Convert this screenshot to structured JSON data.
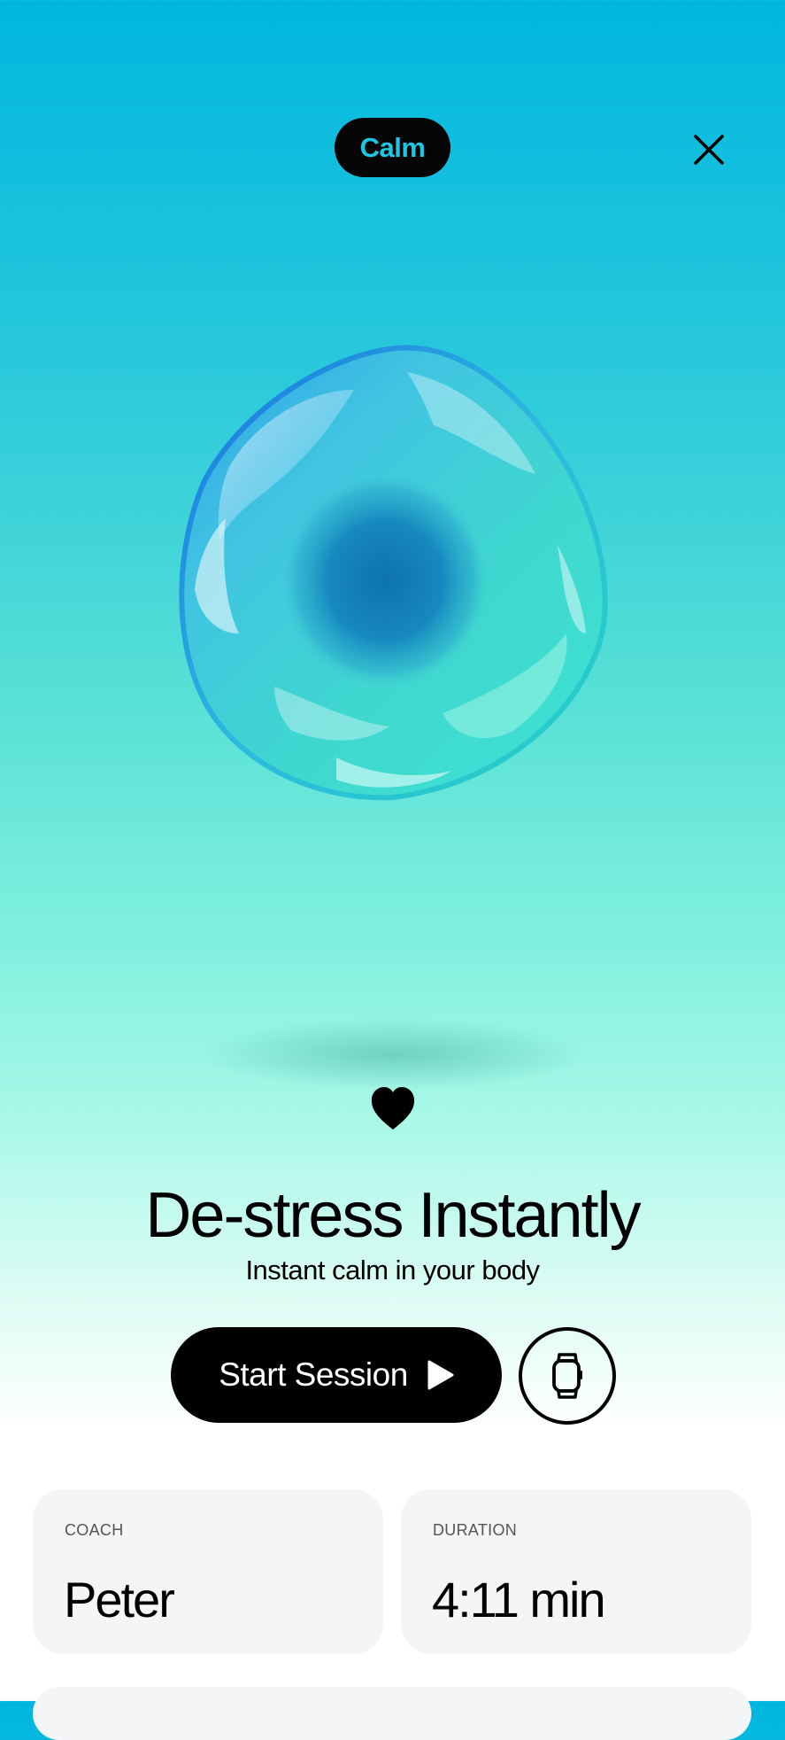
{
  "header": {
    "mode_label": "Calm",
    "close_icon": "close-icon"
  },
  "session": {
    "title": "De-stress Instantly",
    "subtitle": "Instant calm in your body",
    "favorite_icon": "heart-icon"
  },
  "actions": {
    "start_label": "Start Session",
    "start_icon": "play-icon",
    "watch_icon": "watch-icon"
  },
  "details": {
    "coach_label": "COACH",
    "coach_value": "Peter",
    "duration_label": "DURATION",
    "duration_value": "4:11 min"
  }
}
